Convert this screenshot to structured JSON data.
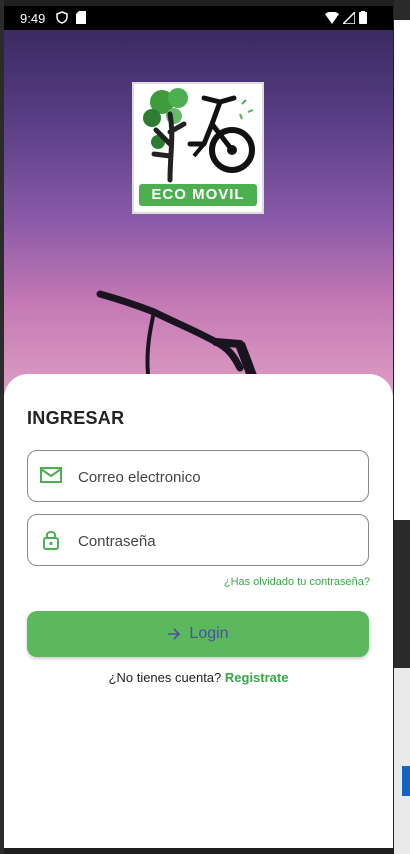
{
  "status_bar": {
    "time": "9:49"
  },
  "brand": {
    "logo_text": "ECO MOVIL"
  },
  "form": {
    "title": "INGRESAR",
    "email_placeholder": "Correo electronico",
    "password_placeholder": "Contraseña",
    "forgot_label": "¿Has olvidado tu contraseña?",
    "login_label": "Login",
    "no_account_text": "¿No tienes cuenta?",
    "register_label": "Registrate"
  },
  "colors": {
    "accent": "#4caf50",
    "login_text": "#4b4fa6"
  }
}
